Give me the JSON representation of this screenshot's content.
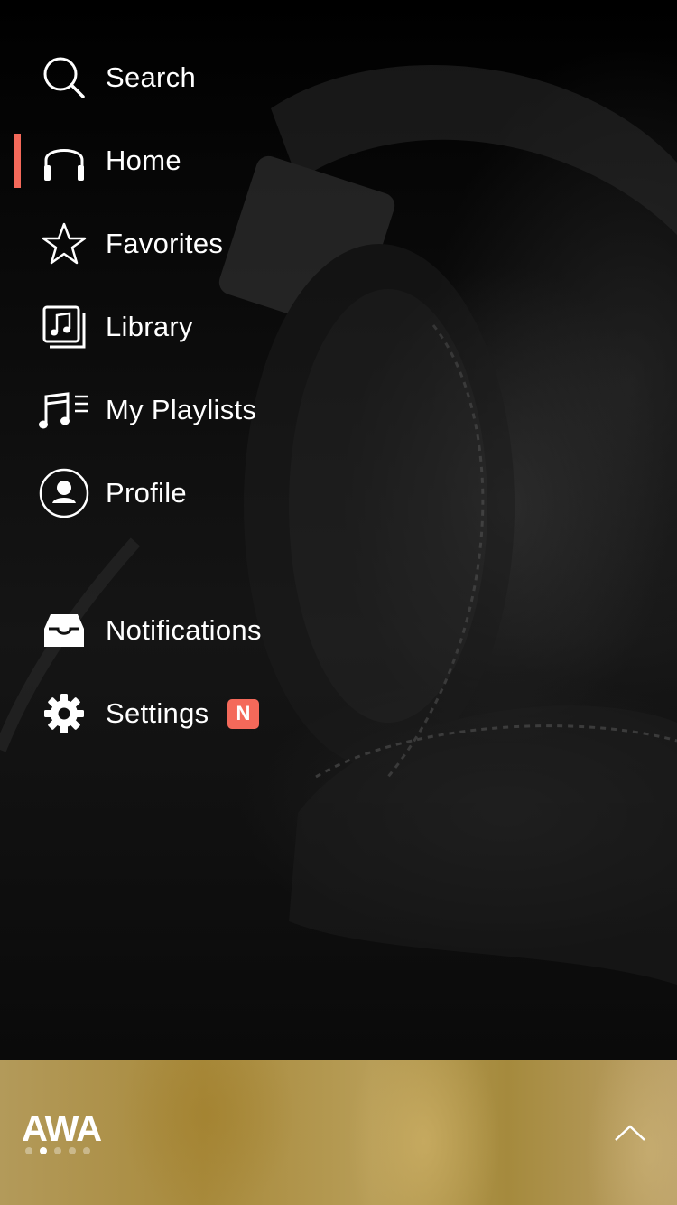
{
  "menu": {
    "items": [
      {
        "label": "Search",
        "icon": "search-icon",
        "active": false
      },
      {
        "label": "Home",
        "icon": "headphones-icon",
        "active": true
      },
      {
        "label": "Favorites",
        "icon": "star-icon",
        "active": false
      },
      {
        "label": "Library",
        "icon": "music-library-icon",
        "active": false
      },
      {
        "label": "My Playlists",
        "icon": "playlist-icon",
        "active": false
      },
      {
        "label": "Profile",
        "icon": "profile-icon",
        "active": false
      },
      {
        "label": "Notifications",
        "icon": "inbox-icon",
        "active": false
      },
      {
        "label": "Settings",
        "icon": "gear-icon",
        "active": false,
        "badge": "N"
      }
    ]
  },
  "player_bar": {
    "logo": "AWA",
    "page_dots": 5,
    "active_dot": 2,
    "expand_icon": "chevron-up-icon"
  },
  "colors": {
    "accent": "#f4695a",
    "player_bar": "#a88a3c"
  }
}
